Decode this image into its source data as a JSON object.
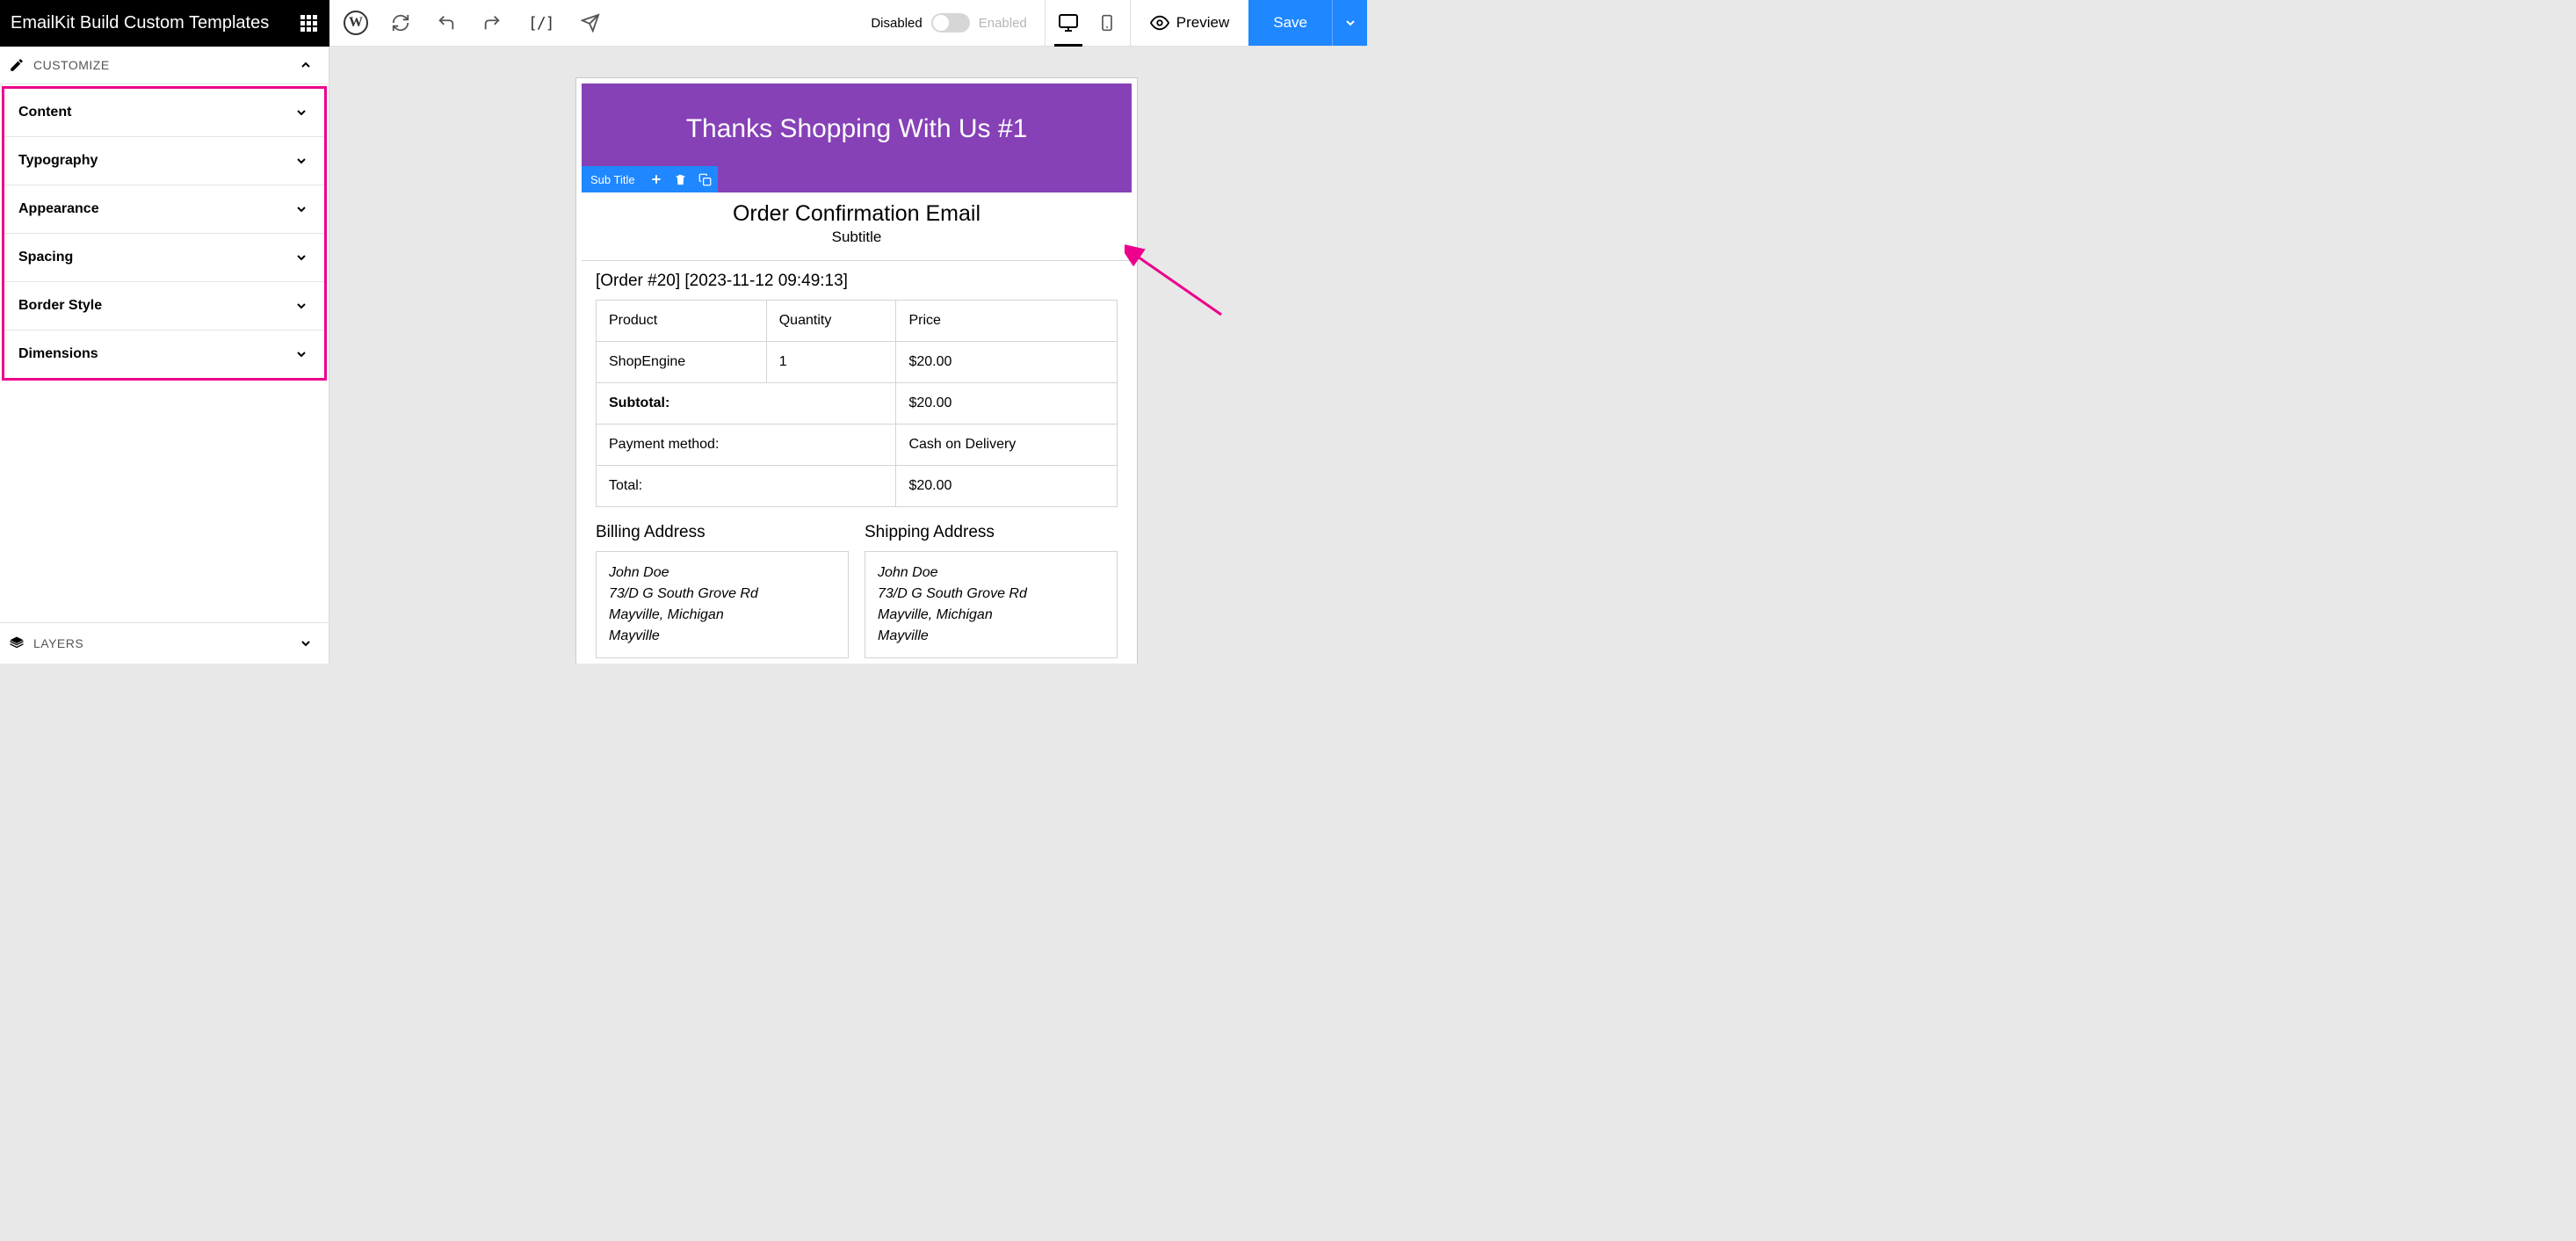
{
  "app_title": "EmailKit Build Custom Templates",
  "sidebar": {
    "customize_label": "CUSTOMIZE",
    "panels": [
      "Content",
      "Typography",
      "Appearance",
      "Spacing",
      "Border Style",
      "Dimensions"
    ],
    "layers_label": "LAYERS"
  },
  "toolbar": {
    "shortcode_glyph": "[/]",
    "toggle_disabled": "Disabled",
    "toggle_enabled": "Enabled",
    "preview_label": "Preview",
    "save_label": "Save"
  },
  "email": {
    "header_text": "Thanks Shopping With Us #1",
    "subtitle_toolbar_label": "Sub Title",
    "title": "Order Confirmation Email",
    "subtitle": "Subtitle",
    "order_meta": "[Order #20] [2023-11-12 09:49:13]",
    "table": {
      "headers": [
        "Product",
        "Quantity",
        "Price"
      ],
      "rows": [
        [
          "ShopEngine",
          "1",
          "$20.00"
        ]
      ],
      "summary": [
        {
          "label": "Subtotal:",
          "value": "$20.00",
          "bold": true
        },
        {
          "label": "Payment method:",
          "value": "Cash on Delivery",
          "bold": false
        },
        {
          "label": "Total:",
          "value": "$20.00",
          "bold": false
        }
      ]
    },
    "billing_title": "Billing Address",
    "shipping_title": "Shipping Address",
    "address_lines": [
      "John Doe",
      "73/D G South Grove Rd",
      "Mayville, Michigan",
      "Mayville"
    ]
  },
  "colors": {
    "accent_pink": "#ec008c",
    "accent_blue": "#1f87ff",
    "header_purple": "#8641b7"
  }
}
